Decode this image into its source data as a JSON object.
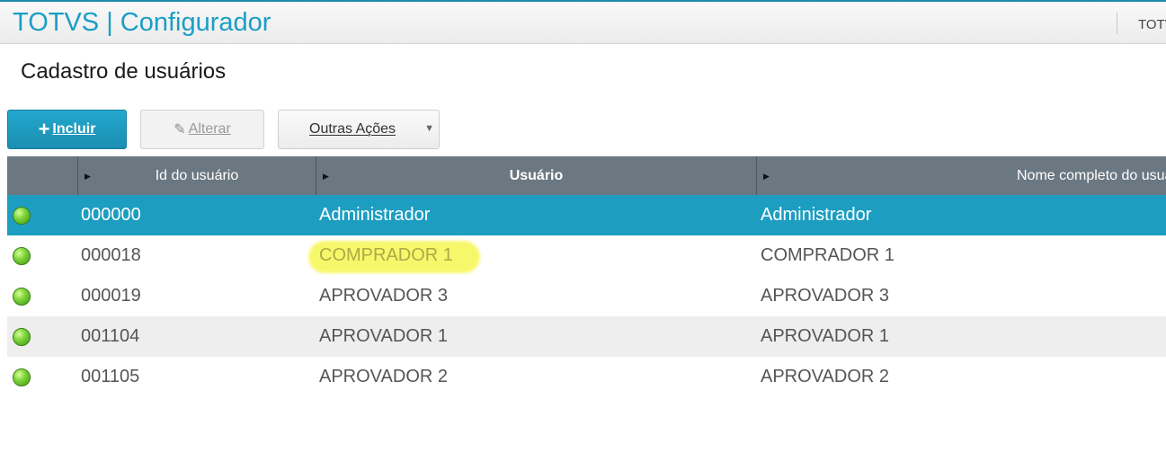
{
  "header": {
    "app_title": "TOTVS | Configurador",
    "right_text": "TOTVS"
  },
  "page": {
    "title": "Cadastro de usuários"
  },
  "toolbar": {
    "incluir_label": "Incluir",
    "alterar_label": "Alterar",
    "outras_acoes_label": "Outras Ações"
  },
  "table": {
    "columns": {
      "id": "Id do usuário",
      "user": "Usuário",
      "name": "Nome completo do usuário"
    },
    "rows": [
      {
        "id": "000000",
        "user": "Administrador",
        "name": "Administrador"
      },
      {
        "id": "000018",
        "user": "COMPRADOR 1",
        "name": "COMPRADOR 1"
      },
      {
        "id": "000019",
        "user": "APROVADOR 3",
        "name": "APROVADOR 3"
      },
      {
        "id": "001104",
        "user": "APROVADOR 1",
        "name": "APROVADOR 1"
      },
      {
        "id": "001105",
        "user": "APROVADOR 2",
        "name": "APROVADOR 2"
      }
    ]
  },
  "colors": {
    "accent": "#1a9ec5",
    "selected_row": "#1d9ec1",
    "header_bg": "#6b7882",
    "highlight": "#f5f53a",
    "status_active": "#7fd43a"
  },
  "icons": {
    "plus": "plus-icon",
    "pencil": "pencil-icon",
    "dropdown": "chevron-down-icon",
    "sort": "sort-arrow-icon",
    "status": "status-green-icon"
  }
}
